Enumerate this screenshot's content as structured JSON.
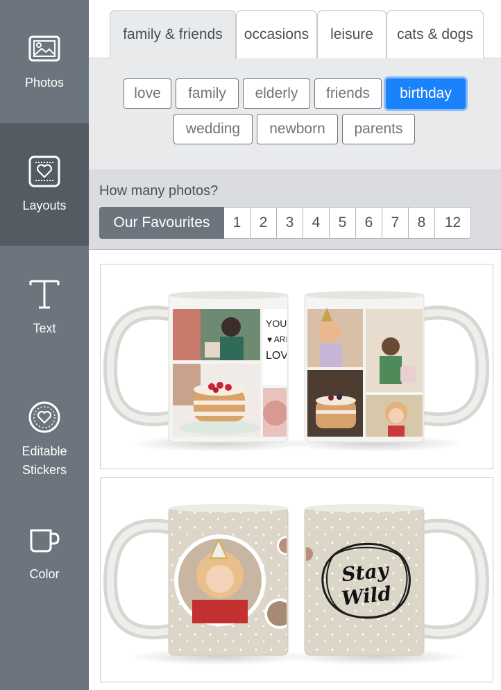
{
  "sidebar": {
    "items": [
      {
        "label": "Photos",
        "icon": "image-icon",
        "active": false
      },
      {
        "label": "Layouts",
        "icon": "heart-frame-icon",
        "active": true
      },
      {
        "label": "Text",
        "icon": "text-t-icon",
        "active": false
      },
      {
        "label": "Editable Stickers",
        "icon": "heart-badge-icon",
        "active": false
      },
      {
        "label": "Color",
        "icon": "mug-icon",
        "active": false
      }
    ]
  },
  "tabs": [
    {
      "label": "family & friends",
      "active": true
    },
    {
      "label": "occasions",
      "active": false
    },
    {
      "label": "leisure",
      "active": false
    },
    {
      "label": "cats & dogs",
      "active": false
    }
  ],
  "subcategories": [
    {
      "label": "love",
      "active": false
    },
    {
      "label": "family",
      "active": false
    },
    {
      "label": "elderly",
      "active": false
    },
    {
      "label": "friends",
      "active": false
    },
    {
      "label": "birthday",
      "active": true
    },
    {
      "label": "wedding",
      "active": false
    },
    {
      "label": "newborn",
      "active": false
    },
    {
      "label": "parents",
      "active": false
    }
  ],
  "photo_count": {
    "label": "How many photos?",
    "options": [
      "Our Favourites",
      "1",
      "2",
      "3",
      "4",
      "5",
      "6",
      "7",
      "8",
      "12"
    ],
    "selected": "Our Favourites"
  },
  "layouts": [
    {
      "mug_text": "YOU ARE LOVED"
    },
    {
      "mug_text": "Stay Wild"
    }
  ],
  "colors": {
    "sidebar": "#6c757d",
    "sidebar_active": "#545b62",
    "accent": "#1a82fb",
    "panel_bg": "#e9eaec"
  }
}
